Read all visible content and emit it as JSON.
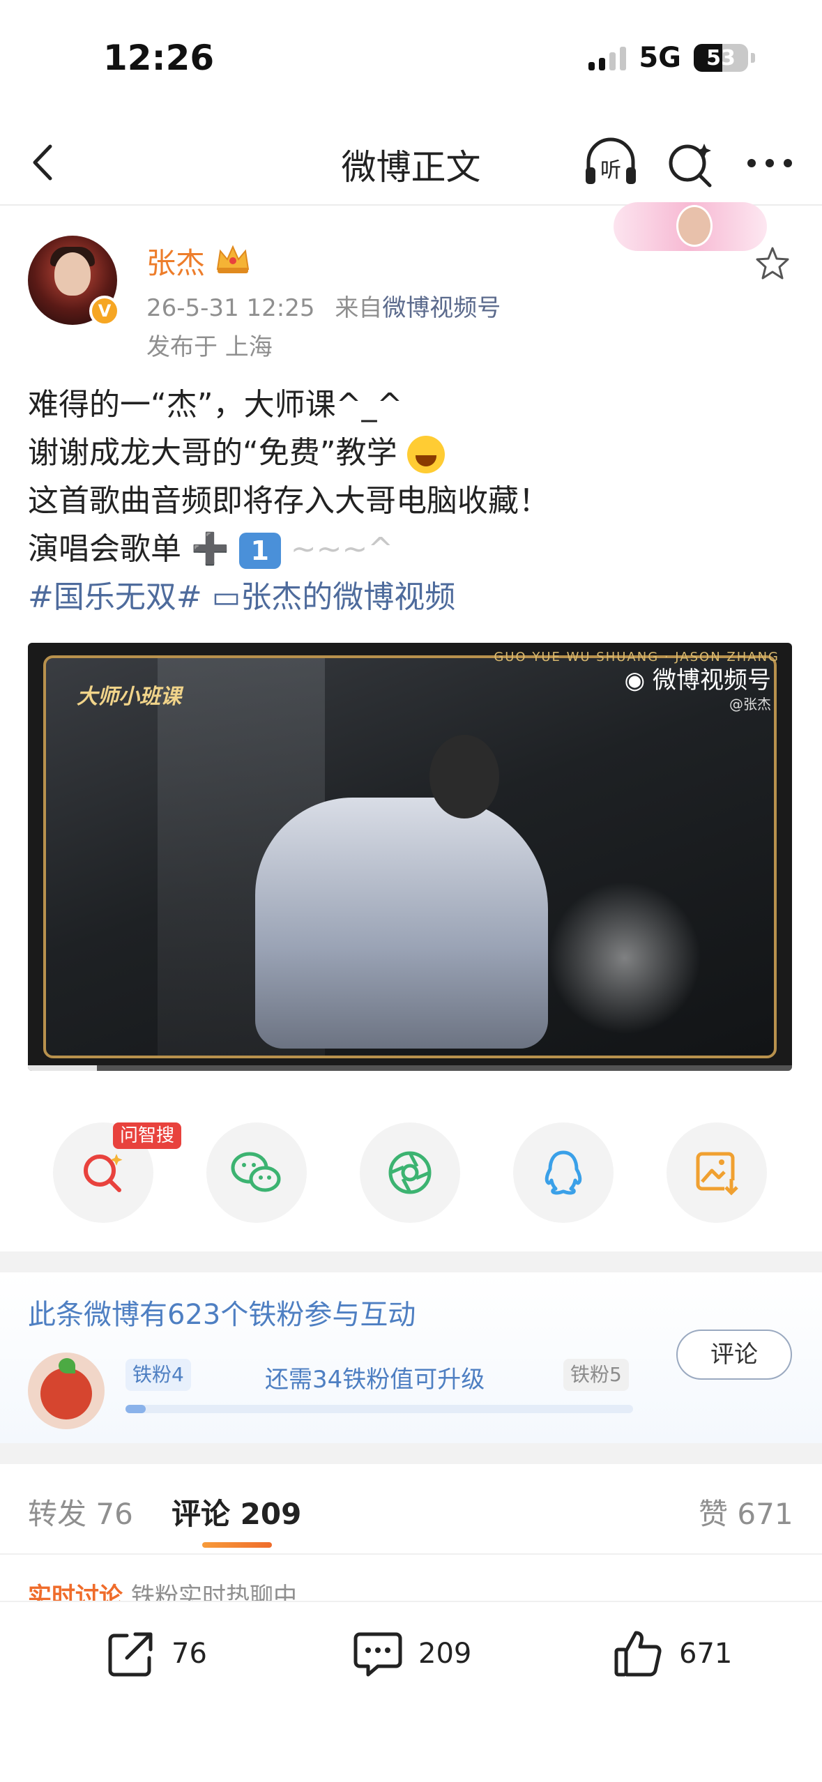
{
  "status_bar": {
    "time": "12:26",
    "network": "5G",
    "battery": "53",
    "battery_level": 0.53
  },
  "nav": {
    "title": "微博正文",
    "icons": [
      "back-icon",
      "listen-icon",
      "search-icon",
      "more-icon"
    ],
    "listen_label": "听"
  },
  "post": {
    "author": "张杰",
    "time": "26-5-31 12:25",
    "source_prefix": "来自",
    "source": "微博视频号",
    "location": "发布于 上海",
    "lines": [
      "难得的一“杰”，大师课^_^",
      "谢谢成龙大哥的“免费”教学",
      "这首歌曲音频即将存入大哥电脑收藏！",
      "演唱会歌单 ➕ ",
      "~~~^"
    ],
    "keycap": "1",
    "hashtag": "#国乐无双#",
    "video_link": "张杰的微博视频"
  },
  "video": {
    "label": "大师小班课",
    "watermark": "微博视频号",
    "sub": "@张杰",
    "frame_text": "GUO YUE WU SHUANG · JASON ZHANG",
    "progress": 0.09
  },
  "share": {
    "badge": "问智搜",
    "buttons": [
      "ai-search-icon",
      "wechat-icon",
      "moments-icon",
      "qq-icon",
      "save-image-icon"
    ]
  },
  "fans": {
    "title": "此条微博有623个铁粉参与互动",
    "level_current": "铁粉4",
    "level_next": "铁粉5",
    "hint": "还需34铁粉值可升级",
    "progress": 0.04,
    "comment_button": "评论"
  },
  "tabs": {
    "repost": "转发",
    "repost_count": "76",
    "comment": "评论",
    "comment_count": "209",
    "like": "赞",
    "like_count": "671"
  },
  "hot_peek": {
    "title": "实时讨论",
    "sub": "铁粉实时热聊中"
  },
  "bottom_bar": {
    "repost_count": "76",
    "comment_count": "209",
    "like_count": "671"
  },
  "colors": {
    "accent": "#ef6c2b",
    "link": "#4e6b9c",
    "fans_blue": "#4e7fc2"
  }
}
